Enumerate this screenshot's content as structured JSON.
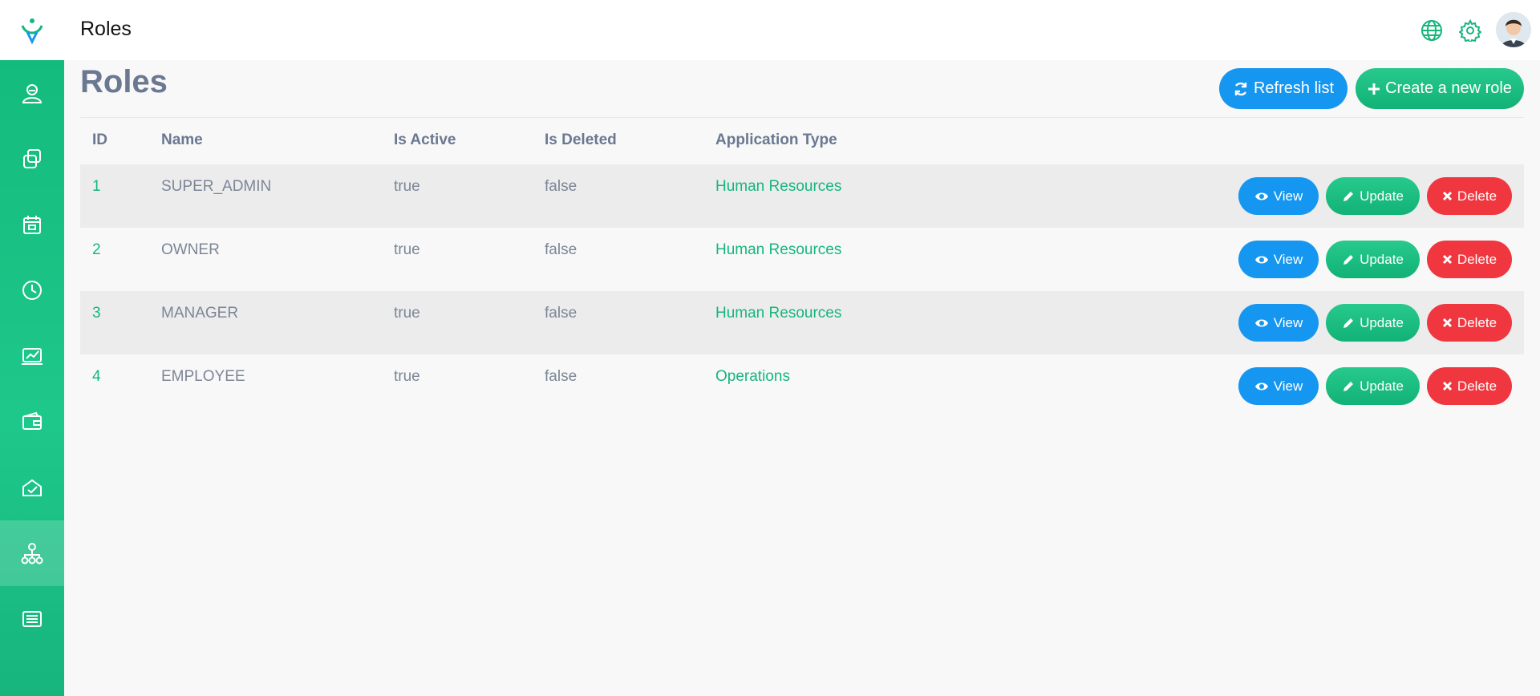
{
  "header": {
    "title": "Roles"
  },
  "sidebar": {
    "items": [
      {
        "name": "user-icon"
      },
      {
        "name": "copy-icon"
      },
      {
        "name": "calendar-icon"
      },
      {
        "name": "clock-icon"
      },
      {
        "name": "chart-icon"
      },
      {
        "name": "wallet-icon"
      },
      {
        "name": "check-box-icon"
      },
      {
        "name": "org-chart-icon",
        "active": true
      },
      {
        "name": "list-icon"
      }
    ]
  },
  "page": {
    "title": "Roles",
    "refresh_label": "Refresh list",
    "create_label": "Create a new role"
  },
  "table": {
    "headers": [
      "ID",
      "Name",
      "Is Active",
      "Is Deleted",
      "Application Type"
    ],
    "rows": [
      {
        "id": "1",
        "name": "SUPER_ADMIN",
        "is_active": "true",
        "is_deleted": "false",
        "app_type": "Human Resources"
      },
      {
        "id": "2",
        "name": "OWNER",
        "is_active": "true",
        "is_deleted": "false",
        "app_type": "Human Resources"
      },
      {
        "id": "3",
        "name": "MANAGER",
        "is_active": "true",
        "is_deleted": "false",
        "app_type": "Human Resources"
      },
      {
        "id": "4",
        "name": "EMPLOYEE",
        "is_active": "true",
        "is_deleted": "false",
        "app_type": "Operations"
      }
    ],
    "actions": {
      "view": "View",
      "update": "Update",
      "delete": "Delete"
    }
  },
  "colors": {
    "accent_green": "#16b67d",
    "blue": "#1596f0",
    "red": "#f0373f"
  }
}
